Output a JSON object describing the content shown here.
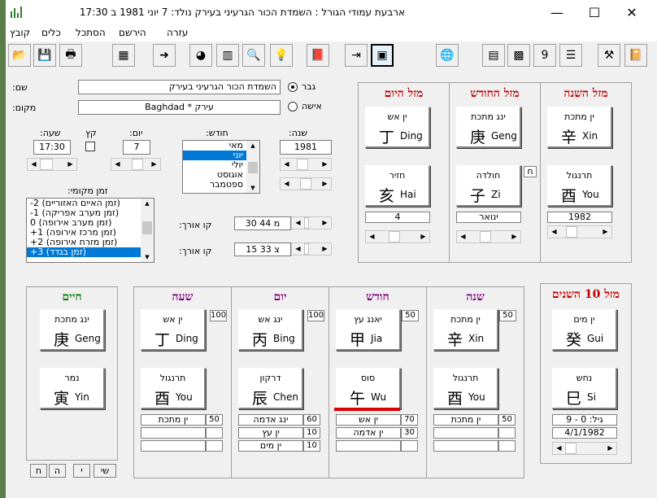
{
  "window": {
    "title": "ארבעת עמודי הגורל : השמדת הכור הגרעיני בעירק    נולד: 7 יוני 1981 ב 17:30",
    "controls": {
      "minimize": "—",
      "maximize": "☐",
      "close": "✕"
    }
  },
  "menu": {
    "items": [
      "קובץ",
      "כלים",
      "הסתכל",
      "הירשם",
      "עזרה"
    ]
  },
  "form": {
    "name_label": "שם:",
    "name_value": "השמדת הכור הגרעיני בעירק",
    "place_label": "מקום:",
    "place_value": "Baghdad * עירק",
    "male_label": "גבר",
    "female_label": "אישה",
    "year_label": "שנה:",
    "year_value": "1981",
    "month_label": "חודש:",
    "months": [
      "מאי",
      "יוני",
      "יולי",
      "אוגוסט",
      "ספטמבר"
    ],
    "month_selected": "יוני",
    "day_label": "יום:",
    "day_value": "7",
    "dst_label": "קץ",
    "hour_label": "שעה:",
    "hour_value": "17:30",
    "tz_label": "זמן מקומי:",
    "timezones": [
      "-2 (זמן האיים האזוריים)",
      "-1 (זמן מערב אפריקה)",
      "0 (זמן מערב אירופה)",
      "+1 (זמן מרכז אירופה)",
      "+2 (זמן מזרח אירופה)",
      "+3 (זמן בגדד)"
    ],
    "tz_selected": "+3 (זמן בגדד)",
    "lon_label": "קו אורך:",
    "lon_value": "מ 44 30",
    "lat_label": "קו אורך:",
    "lat_value": "צ 33 15"
  },
  "luck_panels": [
    {
      "title": "מזל השנה",
      "stem_heb": "ין מתכת",
      "stem_han": "辛",
      "stem_rom": "Xin",
      "branch_heb": "תרנגול",
      "branch_han": "酉",
      "branch_rom": "You",
      "value": "1982"
    },
    {
      "title": "מזל החודש",
      "stem_heb": "ינג מתכת",
      "stem_han": "庚",
      "stem_rom": "Geng",
      "branch_heb": "חולדה",
      "branch_han": "子",
      "branch_rom": "Zi",
      "value": "ינואר",
      "badge": "ח"
    },
    {
      "title": "מזל היום",
      "stem_heb": "ין אש",
      "stem_han": "丁",
      "stem_rom": "Ding",
      "branch_heb": "חזיר",
      "branch_han": "亥",
      "branch_rom": "Hai",
      "value": "4"
    }
  ],
  "pillars": [
    {
      "title": "שנה",
      "title_color": "#800080",
      "stem_heb": "ין מתכת",
      "stem_han": "辛",
      "stem_rom": "Xin",
      "stem_num": "50",
      "branch_heb": "תרנגול",
      "branch_han": "酉",
      "branch_rom": "You",
      "hidden": [
        {
          "num": "50",
          "text": "ין מתכת"
        }
      ]
    },
    {
      "title": "חודש",
      "title_color": "#800080",
      "stem_heb": "יאנג עץ",
      "stem_han": "甲",
      "stem_rom": "Jia",
      "stem_num": "50",
      "branch_heb": "סוס",
      "branch_han": "午",
      "branch_rom": "Wu",
      "hidden": [
        {
          "num": "70",
          "text": "ין אש"
        },
        {
          "num": "30",
          "text": "ין אדמה"
        }
      ]
    },
    {
      "title": "יום",
      "title_color": "#800080",
      "stem_heb": "ינג אש",
      "stem_han": "丙",
      "stem_rom": "Bing",
      "stem_num": "100",
      "branch_heb": "דרקון",
      "branch_han": "辰",
      "branch_rom": "Chen",
      "hidden": [
        {
          "num": "60",
          "text": "ינג אדמה"
        },
        {
          "num": "10",
          "text": "ין עץ"
        },
        {
          "num": "10",
          "text": "ין מים"
        }
      ]
    },
    {
      "title": "שעה",
      "title_color": "#800080",
      "stem_heb": "ין אש",
      "stem_han": "丁",
      "stem_rom": "Ding",
      "stem_num": "100",
      "branch_heb": "תרנגול",
      "branch_han": "酉",
      "branch_rom": "You",
      "hidden": [
        {
          "num": "50",
          "text": "ין מתכת"
        }
      ]
    }
  ],
  "life": {
    "title": "חיים",
    "title_color": "#008000",
    "stem_heb": "ינג מתכת",
    "stem_han": "庚",
    "stem_rom": "Geng",
    "branch_heb": "נמר",
    "branch_han": "寅",
    "branch_rom": "Yin"
  },
  "decade": {
    "title": "מזל 10 השנים",
    "stem_heb": "ין מים",
    "stem_han": "癸",
    "stem_rom": "Gui",
    "branch_heb": "נחש",
    "branch_han": "巳",
    "branch_rom": "Si",
    "age_text": "גיל: 0 - 9",
    "date_text": "4/1/1982"
  },
  "bottom_buttons": [
    "שי",
    "י",
    "ה",
    "ח"
  ],
  "colors": {
    "title_red": "#c00000",
    "accent_blue": "#0078d7",
    "wu_bar": "#e00000"
  }
}
